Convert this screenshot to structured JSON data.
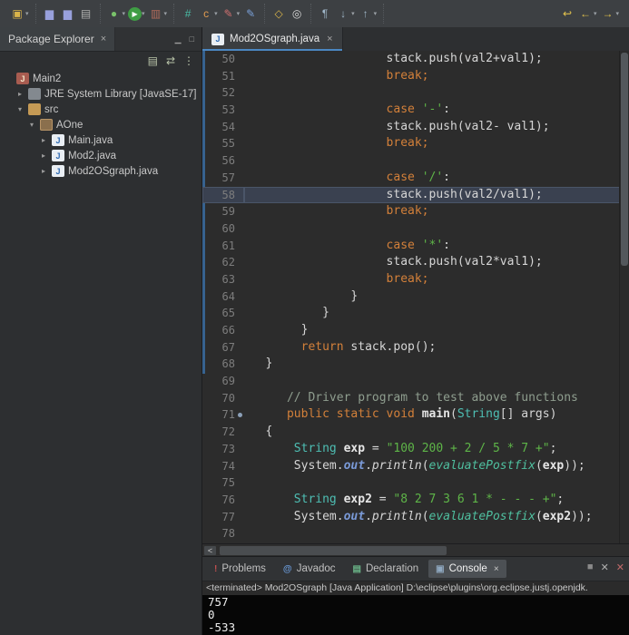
{
  "colors": {
    "tab_accent": "#4b87c2",
    "keyword": "#d3803a",
    "string": "#5eb548",
    "comment": "#8f9e8f",
    "type": "#4ebfb4",
    "console_bg": "#060606",
    "change_bar": "#37628f"
  },
  "toolbar": {
    "groups": [
      {
        "icons": [
          {
            "name": "new-wizard-icon",
            "glyph": "▣",
            "color": "#d9b44a",
            "dd": true
          }
        ]
      },
      {
        "icons": [
          {
            "name": "save-icon",
            "glyph": "▆",
            "color": "#98a0dc"
          },
          {
            "name": "save-all-icon",
            "glyph": "▆",
            "color": "#98a0dc"
          },
          {
            "name": "print-icon",
            "glyph": "▤",
            "color": "#b0b0b0"
          }
        ]
      },
      {
        "icons": [
          {
            "name": "debug-icon",
            "glyph": "●",
            "color": "#79c26a",
            "dd": true
          },
          {
            "name": "run-icon",
            "glyph": "▶",
            "color": "#ffffff",
            "bg": "#3f9d44",
            "dd": true
          },
          {
            "name": "coverage-icon",
            "glyph": "▥",
            "color": "#b06a5a",
            "dd": true
          }
        ]
      },
      {
        "icons": [
          {
            "name": "new-java-class-icon",
            "glyph": "#",
            "color": "#49bda6"
          },
          {
            "name": "new-class-icon",
            "glyph": "c",
            "color": "#e09a50",
            "dd": true
          },
          {
            "name": "new-annotation-icon",
            "glyph": "✎",
            "color": "#d07070",
            "dd": true
          },
          {
            "name": "new-interface-icon",
            "glyph": "✎",
            "color": "#7aa0d8"
          }
        ]
      },
      {
        "icons": [
          {
            "name": "open-type-icon",
            "glyph": "◇",
            "color": "#d9b44a"
          },
          {
            "name": "search-icon",
            "glyph": "◎",
            "color": "#d8d8d8"
          }
        ]
      },
      {
        "icons": [
          {
            "name": "show-whitespace-icon",
            "glyph": "¶",
            "color": "#9fb6c8"
          },
          {
            "name": "next-annotation-icon",
            "glyph": "↓",
            "color": "#9fb6c8",
            "dd": true
          },
          {
            "name": "previous-annotation-icon",
            "glyph": "↑",
            "color": "#9fb6c8",
            "dd": true
          }
        ]
      },
      {
        "right": true,
        "icons": [
          {
            "name": "last-edit-location-icon",
            "glyph": "↩",
            "color": "#e3c34d"
          },
          {
            "name": "back-icon",
            "glyph": "←",
            "color": "#e3c34d",
            "dd": true
          },
          {
            "name": "forward-icon",
            "glyph": "→",
            "color": "#e3c34d",
            "dd": true
          }
        ]
      }
    ]
  },
  "package_explorer": {
    "tab_label": "Package Explorer",
    "close_glyph": "×",
    "minimize_glyph": "▁",
    "maximize_glyph": "□",
    "toolbar_icons": [
      {
        "name": "collapse-all-icon",
        "glyph": "▤"
      },
      {
        "name": "link-with-editor-icon",
        "glyph": "⇄"
      },
      {
        "name": "view-menu-icon",
        "glyph": "⋮"
      }
    ],
    "tree": [
      {
        "label": "Main2",
        "level": 0,
        "chev": "",
        "icon": "java-project-icon",
        "glyph": "J"
      },
      {
        "label": "JRE System Library [JavaSE-17]",
        "level": 1,
        "chev": "▸",
        "icon": "library-icon",
        "glyph": ""
      },
      {
        "label": "src",
        "level": 1,
        "chev": "▾",
        "icon": "source-folder-icon",
        "glyph": ""
      },
      {
        "label": "AOne",
        "level": 2,
        "chev": "▾",
        "icon": "package-icon",
        "glyph": ""
      },
      {
        "label": "Main.java",
        "level": 3,
        "chev": "▸",
        "icon": "java-file-icon",
        "glyph": "J"
      },
      {
        "label": "Mod2.java",
        "level": 3,
        "chev": "▸",
        "icon": "java-file-icon",
        "glyph": "J"
      },
      {
        "label": "Mod2OSgraph.java",
        "level": 3,
        "chev": "▸",
        "icon": "java-file-icon",
        "glyph": "J"
      }
    ]
  },
  "editor": {
    "tab": {
      "label": "Mod2OSgraph.java",
      "icon": "java-file-icon",
      "glyph": "J",
      "close_glyph": "×"
    },
    "hscroll_left_glyph": "<",
    "lines": [
      {
        "n": 50,
        "ind": 20,
        "parts": [
          {
            "t": "stack.push(val2+val1);",
            "c": "pln"
          }
        ]
      },
      {
        "n": 51,
        "ind": 20,
        "parts": [
          {
            "t": "break;",
            "c": "kw"
          }
        ]
      },
      {
        "n": 52,
        "ind": 0,
        "parts": []
      },
      {
        "n": 53,
        "ind": 20,
        "parts": [
          {
            "t": "case ",
            "c": "kw"
          },
          {
            "t": "'-'",
            "c": "str"
          },
          {
            "t": ":",
            "c": "pln"
          }
        ]
      },
      {
        "n": 54,
        "ind": 20,
        "parts": [
          {
            "t": "stack.push(val2- val1);",
            "c": "pln"
          }
        ]
      },
      {
        "n": 55,
        "ind": 20,
        "parts": [
          {
            "t": "break;",
            "c": "kw"
          }
        ]
      },
      {
        "n": 56,
        "ind": 0,
        "parts": []
      },
      {
        "n": 57,
        "ind": 20,
        "parts": [
          {
            "t": "case ",
            "c": "kw"
          },
          {
            "t": "'/'",
            "c": "str"
          },
          {
            "t": ":",
            "c": "pln"
          }
        ]
      },
      {
        "n": 58,
        "ind": 20,
        "hl": true,
        "parts": [
          {
            "t": "stack.push(val2/val1);",
            "c": "pln"
          }
        ]
      },
      {
        "n": 59,
        "ind": 20,
        "parts": [
          {
            "t": "break;",
            "c": "kw"
          }
        ]
      },
      {
        "n": 60,
        "ind": 0,
        "parts": []
      },
      {
        "n": 61,
        "ind": 20,
        "parts": [
          {
            "t": "case ",
            "c": "kw"
          },
          {
            "t": "'*'",
            "c": "str"
          },
          {
            "t": ":",
            "c": "pln"
          }
        ]
      },
      {
        "n": 62,
        "ind": 20,
        "parts": [
          {
            "t": "stack.push(val2*val1);",
            "c": "pln"
          }
        ]
      },
      {
        "n": 63,
        "ind": 20,
        "parts": [
          {
            "t": "break;",
            "c": "kw"
          }
        ]
      },
      {
        "n": 64,
        "ind": 15,
        "parts": [
          {
            "t": "}",
            "c": "pln"
          }
        ]
      },
      {
        "n": 65,
        "ind": 11,
        "parts": [
          {
            "t": "}",
            "c": "pln"
          }
        ]
      },
      {
        "n": 66,
        "ind": 8,
        "parts": [
          {
            "t": "}",
            "c": "pln"
          }
        ]
      },
      {
        "n": 67,
        "ind": 8,
        "parts": [
          {
            "t": "return ",
            "c": "kw"
          },
          {
            "t": "stack.pop();",
            "c": "pln"
          }
        ]
      },
      {
        "n": 68,
        "ind": 3,
        "parts": [
          {
            "t": "}",
            "c": "pln"
          }
        ]
      },
      {
        "n": 69,
        "ind": 0,
        "parts": []
      },
      {
        "n": 70,
        "ind": 6,
        "parts": [
          {
            "t": "// Driver program to test above functions",
            "c": "com"
          }
        ]
      },
      {
        "n": 71,
        "ind": 6,
        "marker": true,
        "parts": [
          {
            "t": "public static void ",
            "c": "kw"
          },
          {
            "t": "main",
            "c": "meth"
          },
          {
            "t": "(",
            "c": "pln"
          },
          {
            "t": "String",
            "c": "typ"
          },
          {
            "t": "[] ",
            "c": "pln"
          },
          {
            "t": "args",
            "c": "pln"
          },
          {
            "t": ")",
            "c": "pln"
          }
        ]
      },
      {
        "n": 72,
        "ind": 3,
        "parts": [
          {
            "t": "{",
            "c": "pln"
          }
        ]
      },
      {
        "n": 73,
        "ind": 7,
        "parts": [
          {
            "t": "String",
            "c": "typ"
          },
          {
            "t": " ",
            "c": "pln"
          },
          {
            "t": "exp",
            "c": "var"
          },
          {
            "t": " = ",
            "c": "pln"
          },
          {
            "t": "\"100 200 + 2 / 5 * 7 +\"",
            "c": "str"
          },
          {
            "t": ";",
            "c": "pln"
          }
        ]
      },
      {
        "n": 74,
        "ind": 7,
        "parts": [
          {
            "t": "System",
            "c": "pln"
          },
          {
            "t": ".",
            "c": "pln"
          },
          {
            "t": "out",
            "c": "fld"
          },
          {
            "t": ".",
            "c": "pln"
          },
          {
            "t": "println",
            "c": "mth"
          },
          {
            "t": "(",
            "c": "pln"
          },
          {
            "t": "evaluatePostfix",
            "c": "smeth"
          },
          {
            "t": "(",
            "c": "pln"
          },
          {
            "t": "exp",
            "c": "var"
          },
          {
            "t": "));",
            "c": "pln"
          }
        ]
      },
      {
        "n": 75,
        "ind": 0,
        "parts": []
      },
      {
        "n": 76,
        "ind": 7,
        "parts": [
          {
            "t": "String",
            "c": "typ"
          },
          {
            "t": " ",
            "c": "pln"
          },
          {
            "t": "exp2",
            "c": "var"
          },
          {
            "t": " = ",
            "c": "pln"
          },
          {
            "t": "\"8 2 7 3 6 1 * - - - +\"",
            "c": "str"
          },
          {
            "t": ";",
            "c": "pln"
          }
        ]
      },
      {
        "n": 77,
        "ind": 7,
        "parts": [
          {
            "t": "System",
            "c": "pln"
          },
          {
            "t": ".",
            "c": "pln"
          },
          {
            "t": "out",
            "c": "fld"
          },
          {
            "t": ".",
            "c": "pln"
          },
          {
            "t": "println",
            "c": "mth"
          },
          {
            "t": "(",
            "c": "pln"
          },
          {
            "t": "evaluatePostfix",
            "c": "smeth"
          },
          {
            "t": "(",
            "c": "pln"
          },
          {
            "t": "exp2",
            "c": "var"
          },
          {
            "t": "));",
            "c": "pln"
          }
        ]
      },
      {
        "n": 78,
        "ind": 0,
        "parts": []
      }
    ]
  },
  "bottom": {
    "tabs": [
      {
        "label": "Problems",
        "icon": "problems-icon",
        "glyph": "!",
        "color": "#c05050",
        "active": false
      },
      {
        "label": "Javadoc",
        "icon": "javadoc-icon",
        "glyph": "@",
        "color": "#6a9ad8",
        "active": false
      },
      {
        "label": "Declaration",
        "icon": "declaration-icon",
        "glyph": "▤",
        "color": "#6ab588",
        "active": false
      },
      {
        "label": "Console",
        "icon": "console-icon",
        "glyph": "▣",
        "color": "#8fa8c0",
        "active": true
      }
    ],
    "active_close_glyph": "×",
    "right_icons": [
      {
        "name": "terminate-icon",
        "glyph": "■",
        "color": "#8a8a8a"
      },
      {
        "name": "remove-launch-icon",
        "glyph": "✕",
        "color": "#b0b0b0"
      },
      {
        "name": "remove-all-launches-icon",
        "glyph": "✕",
        "color": "#c06a6a"
      }
    ],
    "console_header": "<terminated> Mod2OSgraph [Java Application] D:\\eclipse\\plugins\\org.eclipse.justj.openjdk.",
    "console_lines": [
      "757",
      "0",
      "-533"
    ]
  }
}
